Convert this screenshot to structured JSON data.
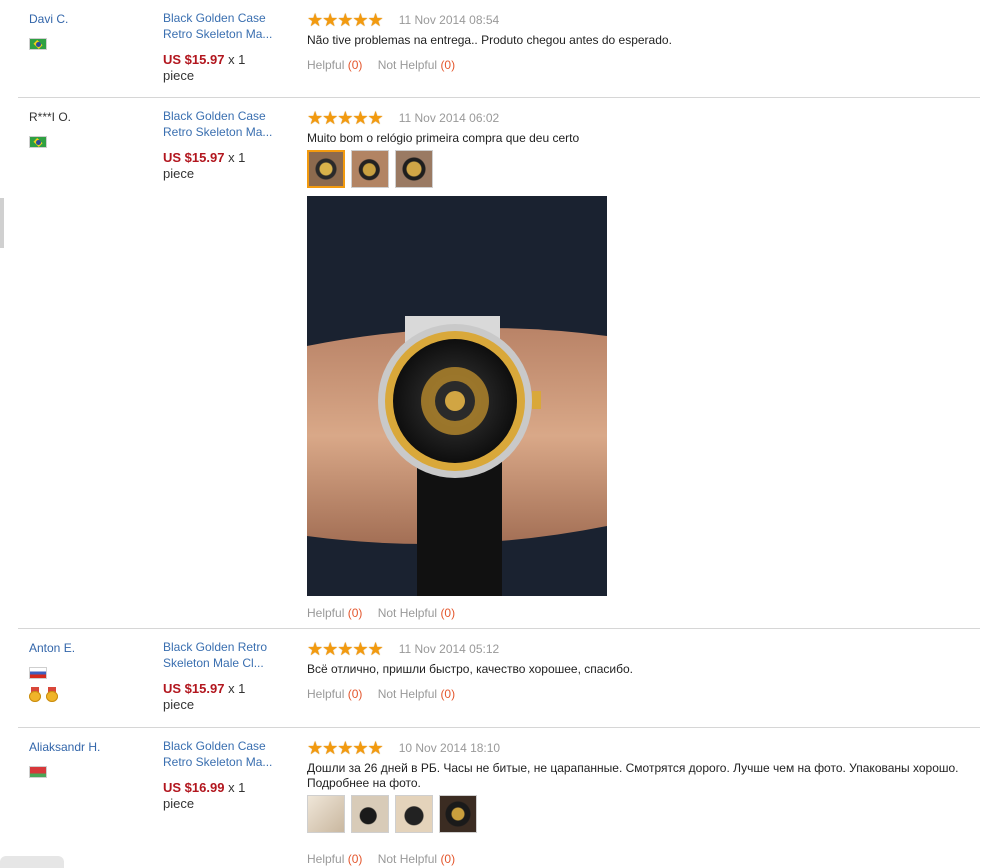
{
  "helpful_label": "Helpful",
  "not_helpful_label": "Not Helpful",
  "reviews": [
    {
      "buyer": "Davi C.",
      "country": "br",
      "product": [
        "Black Golden Case",
        "Retro Skeleton Ma..."
      ],
      "price": "US $15.97",
      "qty": "x 1",
      "unit": "piece",
      "stars": "★★★★★",
      "date": "11 Nov 2014 08:54",
      "text": "Não tive problemas na entrega.. Produto chegou antes do esperado.",
      "helpful": "(0)",
      "not_helpful": "(0)"
    },
    {
      "buyer": "R***I O.",
      "country": "br",
      "product": [
        "Black Golden Case",
        "Retro Skeleton Ma..."
      ],
      "price": "US $15.97",
      "qty": "x 1",
      "unit": "piece",
      "stars": "★★★★★",
      "date": "11 Nov 2014 06:02",
      "text": "Muito bom o relógio primeira compra que deu certo",
      "helpful": "(0)",
      "not_helpful": "(0)"
    },
    {
      "buyer": "Anton E.",
      "country": "ru",
      "product": [
        "Black Golden Retro",
        "Skeleton Male Cl..."
      ],
      "price": "US $15.97",
      "qty": "x 1",
      "unit": "piece",
      "stars": "★★★★★",
      "date": "11 Nov 2014 05:12",
      "text": "Всё отлично, пришли быстро, качество хорошее, спасибо.",
      "helpful": "(0)",
      "not_helpful": "(0)"
    },
    {
      "buyer": "Aliaksandr H.",
      "country": "by",
      "product": [
        "Black Golden Case",
        "Retro Skeleton Ma..."
      ],
      "price": "US $16.99",
      "qty": "x 1",
      "unit": "piece",
      "stars": "★★★★★",
      "date": "10 Nov 2014 18:10",
      "text": "Дошли за 26 дней в РБ. Часы не битые, не царапанные. Смотрятся дорого. Лучше чем на фото. Упакованы хорошо. Подробнее на фото.",
      "helpful": "(0)",
      "not_helpful": "(0)"
    }
  ],
  "colors": {
    "link": "#3a6fb0",
    "price": "#b2161e",
    "stars": "#f29a0f",
    "count": "#e4572e"
  }
}
